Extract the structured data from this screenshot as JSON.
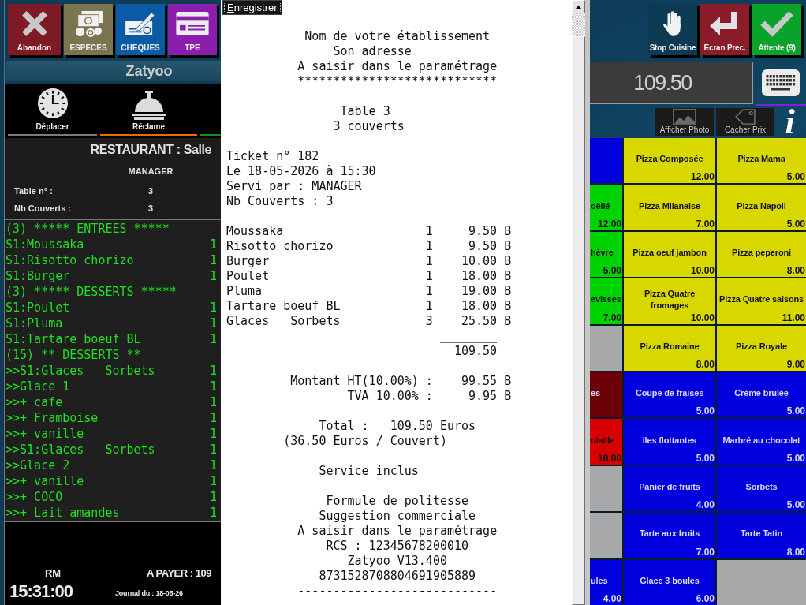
{
  "left_panel": {
    "payment_buttons": [
      {
        "label": "Abandon",
        "color": "#7d1a25"
      },
      {
        "label": "ESPECES",
        "color": "#7a7550"
      },
      {
        "label": "CHEQUES",
        "color": "#0b5aa5"
      },
      {
        "label": "TPE",
        "color": "#8b1ead"
      }
    ],
    "app_name": "Zatyoo",
    "tools": [
      {
        "label": "Déplacer",
        "color": "#7a7a7a"
      },
      {
        "label": "Réclame",
        "color": "#e86a00"
      },
      {
        "color": "#12901a"
      }
    ],
    "room": "RESTAURANT : Salle",
    "server": "MANAGER",
    "fields": [
      {
        "label": "Table n° :",
        "value": "3"
      },
      {
        "label": "Nb Couverts :",
        "value": "3"
      }
    ],
    "order_lines": [
      {
        "text": "(3) ***** ENTREES *****"
      },
      {
        "text": "S1:Moussaka",
        "qty": "1"
      },
      {
        "text": "S1:Risotto chorizo",
        "qty": "1"
      },
      {
        "text": "S1:Burger",
        "qty": "1"
      },
      {
        "text": "(3) ***** DESSERTS *****"
      },
      {
        "text": "S1:Poulet",
        "qty": "1"
      },
      {
        "text": "S1:Pluma",
        "qty": "1"
      },
      {
        "text": "S1:Tartare boeuf BL",
        "qty": "1"
      },
      {
        "text": "(15) ** DESSERTS **"
      },
      {
        "text": ">>S1:Glaces   Sorbets",
        "qty": "1"
      },
      {
        "text": ">>Glace 1",
        "qty": "1"
      },
      {
        "text": ">>+ cafe",
        "qty": "1"
      },
      {
        "text": ">>+ Framboise",
        "qty": "1"
      },
      {
        "text": ">>+ vanille",
        "qty": "1"
      },
      {
        "text": ">>S1:Glaces   Sorbets",
        "qty": "1"
      },
      {
        "text": ">>Glace 2",
        "qty": "1"
      },
      {
        "text": ">>+ vanille",
        "qty": "1"
      },
      {
        "text": ">>+ COCO",
        "qty": "1"
      },
      {
        "text": ">>+ Lait amandes",
        "qty": "1"
      }
    ],
    "footer": {
      "mode": "RM",
      "to_pay_label": "A PAYER :",
      "to_pay_value": "109",
      "clock": "15:31:00",
      "journal": "Journal du : 18-05-26"
    }
  },
  "receipt": {
    "save_button": "Enregistrer",
    "blocks": [
      {
        "kind": "lines",
        "lines": [
          "Nom de votre établissement",
          "Son adresse",
          "A saisir dans le paramétrage",
          "****************************"
        ]
      },
      {
        "kind": "lines",
        "lines": [
          "Table 3",
          "3 couverts"
        ]
      },
      {
        "kind": "lines",
        "lines": [
          "Ticket n° 182",
          "Le 18-05-2026 à 15:30",
          "Servi par : MANAGER",
          "Nb Couverts : 3"
        ]
      },
      {
        "kind": "items",
        "items": [
          {
            "name": "Moussaka",
            "qty": "1",
            "amount": "9.50 B"
          },
          {
            "name": "Risotto chorizo",
            "qty": "1",
            "amount": "9.50 B"
          },
          {
            "name": "Burger",
            "qty": "1",
            "amount": "10.00 B"
          },
          {
            "name": "Poulet",
            "qty": "1",
            "amount": "18.00 B"
          },
          {
            "name": "Pluma",
            "qty": "1",
            "amount": "19.00 B"
          },
          {
            "name": "Tartare boeuf BL",
            "qty": "1",
            "amount": "18.00 B"
          },
          {
            "name": "Glaces   Sorbets",
            "qty": "3",
            "amount": "25.50 B"
          }
        ],
        "rule": "________",
        "subtotal": "109.50"
      },
      {
        "kind": "taxes",
        "taxes": [
          {
            "label": "Montant HT(10.00%) :",
            "amount": "99.55 B"
          },
          {
            "label": "TVA 10.00% :",
            "amount": "9.95 B"
          }
        ]
      },
      {
        "kind": "lines",
        "lines": [
          "Total :   109.50 Euros",
          "(36.50 Euros / Couvert)"
        ]
      },
      {
        "kind": "lines",
        "lines": [
          "Service inclus"
        ]
      },
      {
        "kind": "lines",
        "lines": [
          "Formule de politesse",
          "Suggestion commerciale",
          "A saisir dans le paramétrage",
          "RCS : 12345678200010",
          "Zatyoo V13.400",
          "8731528708804691905889",
          "----------------------------"
        ]
      }
    ]
  },
  "right_panel": {
    "action_buttons": [
      {
        "label": "Stop Cuisine",
        "color": "#0c3a52"
      },
      {
        "label": "Ecran Prec.",
        "color": "#8a1b29"
      },
      {
        "label": "Attente (9)",
        "color": "#09a32b"
      }
    ],
    "amount": "109.50",
    "view_buttons": [
      {
        "label": "Afficher Photo"
      },
      {
        "label": "Cacher Prix"
      }
    ],
    "info_button": "i",
    "products": [
      {
        "color": "#0000dc"
      },
      {
        "name": "Pizza Composée",
        "price": "12.00",
        "color": "#d8d800"
      },
      {
        "name": "Pizza Mama",
        "price": "5.00",
        "color": "#d8d800"
      },
      {
        "name": "oëllé",
        "price": "12.00",
        "color": "#00d200"
      },
      {
        "name": "Pizza Milanaise",
        "price": "7.00",
        "color": "#d8d800"
      },
      {
        "name": "Pizza Napoli",
        "price": "5.00",
        "color": "#d8d800"
      },
      {
        "name": "hèvre",
        "price": "5.00",
        "color": "#00d200"
      },
      {
        "name": "Pizza oeuf jambon",
        "price": "10.00",
        "color": "#d8d800"
      },
      {
        "name": "Pizza peperoni",
        "price": "8.00",
        "color": "#d8d800"
      },
      {
        "name": "evisses",
        "price": "7.00",
        "color": "#00d200"
      },
      {
        "name": "Pizza Quatre fromages",
        "price": "10.00",
        "color": "#d8d800"
      },
      {
        "name": "Pizza Quatre saisons",
        "price": "11.00",
        "color": "#d8d800"
      },
      {
        "color": "#a6a8a9"
      },
      {
        "name": "Pizza Romaine",
        "price": "8.00",
        "color": "#d8d800"
      },
      {
        "name": "Pizza Royale",
        "price": "9.00",
        "color": "#d8d800"
      },
      {
        "name": "es",
        "color": "#6b0008"
      },
      {
        "name": "Coupe de fraises",
        "price": "5.00",
        "color": "#0000dc"
      },
      {
        "name": "Crème brulée",
        "price": "5.00",
        "color": "#0000dc"
      },
      {
        "name": "olaille",
        "price": "10.00",
        "color": "#d60000"
      },
      {
        "name": "Iles flottantes",
        "price": "5.00",
        "color": "#0000dc"
      },
      {
        "name": "Marbré au chocolat",
        "price": "5.00",
        "color": "#0000dc"
      },
      {
        "color": "#a6a8a9"
      },
      {
        "name": "Panier de fruits",
        "price": "4.00",
        "color": "#0000dc"
      },
      {
        "name": "Sorbets",
        "price": "5.00",
        "color": "#0000dc"
      },
      {
        "color": "#a6a8a9"
      },
      {
        "name": "Tarte aux fruits",
        "price": "7.00",
        "color": "#0000dc"
      },
      {
        "name": "Tarte Tatin",
        "price": "8.00",
        "color": "#0000dc"
      },
      {
        "name": "ules",
        "price": "4.00",
        "color": "#0000dc"
      },
      {
        "name": "Glace 3 boules",
        "price": "6.00",
        "color": "#0000dc"
      },
      {
        "color": "#a6a8a9"
      }
    ]
  }
}
